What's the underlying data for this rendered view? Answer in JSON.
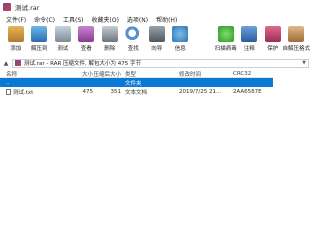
{
  "window": {
    "title": "测试.rar"
  },
  "menu": [
    "文件(F)",
    "命令(C)",
    "工具(S)",
    "收藏夹(O)",
    "选项(N)",
    "帮助(H)"
  ],
  "toolbar": {
    "items": [
      {
        "label": "添加",
        "icon": "add-icon"
      },
      {
        "label": "解压到",
        "icon": "extract-icon"
      },
      {
        "label": "测试",
        "icon": "test-icon"
      },
      {
        "label": "查看",
        "icon": "view-icon"
      },
      {
        "label": "删除",
        "icon": "delete-icon"
      },
      {
        "label": "查找",
        "icon": "find-icon"
      },
      {
        "label": "向导",
        "icon": "wizard-icon"
      },
      {
        "label": "信息",
        "icon": "info-icon"
      },
      {
        "label": "扫描病毒",
        "icon": "virus-scan-icon"
      },
      {
        "label": "注释",
        "icon": "comment-icon"
      },
      {
        "label": "保护",
        "icon": "protect-icon"
      },
      {
        "label": "自解压格式",
        "icon": "sfx-icon"
      }
    ]
  },
  "address": {
    "text": "测试.rar - RAR 压缩文件, 解包大小为 475 字节"
  },
  "columns": [
    "名称",
    "大小",
    "压缩后大小",
    "类型",
    "修改时间",
    "CRC32"
  ],
  "rows": [
    {
      "name": "..",
      "size": "",
      "packed": "",
      "type": "文件夹",
      "modified": "",
      "crc": ""
    },
    {
      "name": "测试.txt",
      "size": "475",
      "packed": "351",
      "type": "文本文档",
      "modified": "2019/7/25 21...",
      "crc": "2AA6587E"
    }
  ]
}
